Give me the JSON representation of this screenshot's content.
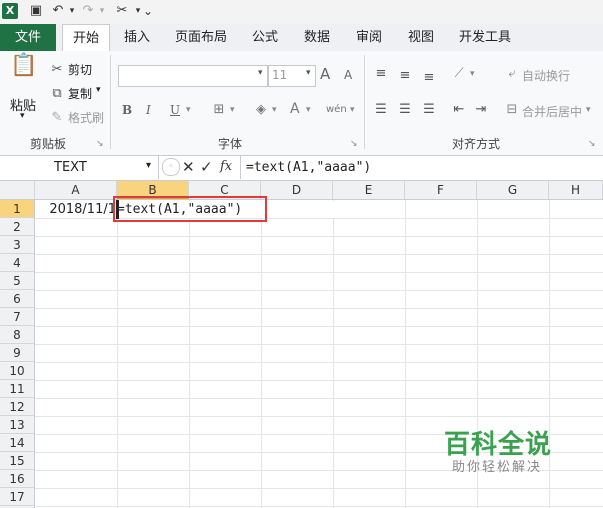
{
  "qat": {
    "app_icon": "X"
  },
  "tabs": [
    "文件",
    "开始",
    "插入",
    "页面布局",
    "公式",
    "数据",
    "审阅",
    "视图",
    "开发工具"
  ],
  "clipboard": {
    "paste": "粘贴",
    "cut": "剪切",
    "copy": "复制",
    "format_painter": "格式刷",
    "group_label": "剪贴板"
  },
  "font": {
    "size": "11",
    "group_label": "字体",
    "bold": "B",
    "italic": "I",
    "underline": "U",
    "grow": "A",
    "shrink": "A"
  },
  "alignment": {
    "wrap_text": "自动换行",
    "merge_center": "合并后居中",
    "group_label": "对齐方式"
  },
  "formula_bar": {
    "name_box": "TEXT",
    "cancel": "✕",
    "enter": "✓",
    "fx": "fx",
    "formula": "=text(A1,\"aaaa\")"
  },
  "columns": [
    "A",
    "B",
    "C",
    "D",
    "E",
    "F",
    "G",
    "H"
  ],
  "rows": [
    "1",
    "2",
    "3",
    "4",
    "5",
    "6",
    "7",
    "8",
    "9",
    "10",
    "11",
    "12",
    "13",
    "14",
    "15",
    "16",
    "17"
  ],
  "cells": {
    "A1": "2018/11/1",
    "B1_editing": "=text(A1,\"aaaa\")"
  },
  "watermark": {
    "title": "百科全说",
    "subtitle": "助你轻松解决"
  }
}
